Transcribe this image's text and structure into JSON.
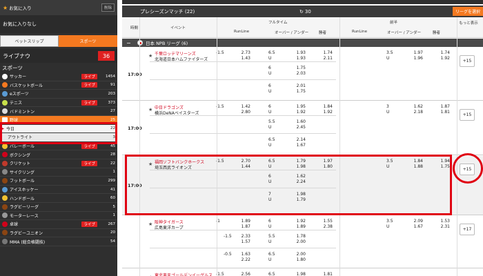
{
  "sidebar": {
    "favorites_title": "お気に入り",
    "favorites_button": "削除",
    "favorites_empty": "お気に入りなし",
    "tabs": [
      "ベットスリップ",
      "スポーツ"
    ],
    "live_now_label": "ライブナウ",
    "live_now_count": "36",
    "sports_header": "スポーツ",
    "sports": [
      {
        "name": "サッカー",
        "live": "ライブ",
        "count": "1454",
        "icon_color": "#ffffff"
      },
      {
        "name": "バスケットボール",
        "live": "ライブ",
        "count": "91",
        "icon_color": "#f47920"
      },
      {
        "name": "eスポーツ",
        "live": "",
        "count": "203",
        "icon_color": "#5a9bd4"
      },
      {
        "name": "テニス",
        "live": "ライブ",
        "count": "373",
        "icon_color": "#c8e04a"
      },
      {
        "name": "バドミントン",
        "live": "",
        "count": "27",
        "icon_color": "#dddddd"
      },
      {
        "name": "野球",
        "live": "",
        "count": "25",
        "icon_color": "#ffffff",
        "selected": true
      },
      {
        "name": "今日",
        "live": "",
        "count": "22",
        "icon_color": "",
        "sub": true
      },
      {
        "name": "アウトライト",
        "live": "",
        "count": "3",
        "icon_color": "",
        "sub2": true
      },
      {
        "name": "バレーボール",
        "live": "ライブ",
        "count": "45",
        "icon_color": "#f2c230"
      },
      {
        "name": "ボクシング",
        "live": "",
        "count": "28",
        "icon_color": "#d0021b"
      },
      {
        "name": "クリケット",
        "live": "ライブ",
        "count": "22",
        "icon_color": "#c0392b"
      },
      {
        "name": "サイクリング",
        "live": "",
        "count": "1",
        "icon_color": "#888888"
      },
      {
        "name": "フットボール",
        "live": "",
        "count": "299",
        "icon_color": "#8b4513"
      },
      {
        "name": "アイスホッケー",
        "live": "",
        "count": "41",
        "icon_color": "#5a9bd4"
      },
      {
        "name": "ハンドボール",
        "live": "",
        "count": "60",
        "icon_color": "#f2c230"
      },
      {
        "name": "ラグビーリーグ",
        "live": "",
        "count": "5",
        "icon_color": "#8b4513"
      },
      {
        "name": "モーターレース",
        "live": "",
        "count": "1",
        "icon_color": "#999999"
      },
      {
        "name": "卓球",
        "live": "ライブ",
        "count": "267",
        "icon_color": "#d0021b"
      },
      {
        "name": "ラグビーユニオン",
        "live": "",
        "count": "20",
        "icon_color": "#8b4513"
      },
      {
        "name": "MMA (総合格闘技)",
        "live": "",
        "count": "54",
        "icon_color": "#777777"
      }
    ]
  },
  "main": {
    "title": "プレシーズンマッチ (22)",
    "refresh_count": "30",
    "order_button": "リーグを選択",
    "headers": {
      "time": "時間",
      "event": "イベント",
      "full_time": "フルタイム",
      "first_half": "前半",
      "runline": "RunLine",
      "over_under": "オーバー / アンダー",
      "win": "勝者",
      "more_display": "もっと表示"
    },
    "league": "日本 NPB リーグ (6)",
    "matches": [
      {
        "time": "17:00",
        "home": "千葉ロッテマリーンズ",
        "away": "北海道日本ハムファイターズ",
        "rl_h": "-1.5",
        "rl_ho": "2.73",
        "rl_ao": "1.43",
        "ou_line": "6.5",
        "ou_o": "1.93",
        "ou_u": "1.93",
        "w1": "1.74",
        "w2": "2.11",
        "h_rl": "3.5",
        "h_o": "1.97",
        "h_u": "1.96",
        "hw1": "1.74",
        "hw2": "1.92",
        "alts": [
          {
            "line": "6",
            "o": "1.75",
            "u": "2.03"
          },
          {
            "line": "6",
            "o": "2.01",
            "u": "1.75"
          }
        ],
        "more": "+15"
      },
      {
        "time": "17:00",
        "home": "中日ドラゴンズ",
        "away": "横浜DeNAベイスターズ",
        "rl_h": "-1.5",
        "rl_ho": "1.42",
        "rl_ao": "2.80",
        "ou_line": "6",
        "ou_o": "1.95",
        "ou_u": "1.92",
        "w1": "1.84",
        "w2": "1.92",
        "h_rl": "3",
        "h_o": "1.62",
        "h_u": "2.18",
        "hw1": "1.87",
        "hw2": "1.81",
        "alts": [
          {
            "line": "5.5",
            "o": "1.60",
            "u": "2.45"
          },
          {
            "line": "6.5",
            "o": "2.14",
            "u": "1.67"
          }
        ],
        "more": "+15"
      },
      {
        "time": "17:00",
        "home": "福岡ソフトバンクホークス",
        "away": "埼玉西武ライオンズ",
        "rl_h": "-1.5",
        "rl_ho": "2.70",
        "rl_ao": "1.44",
        "ou_line": "6.5",
        "ou_o": "1.79",
        "ou_u": "1.98",
        "w1": "1.97",
        "w2": "1.80",
        "h_rl": "3.5",
        "h_o": "1.84",
        "h_u": "1.88",
        "hw1": "1.94",
        "hw2": "1.75",
        "alts": [
          {
            "line": "6",
            "o": "1.62",
            "u": "2.24"
          },
          {
            "line": "7",
            "o": "1.98",
            "u": "1.79"
          }
        ],
        "more": "+15"
      },
      {
        "time": "",
        "home": "阪神タイガース",
        "away": "広島東洋カープ",
        "rl_h": "-1",
        "rl_ho": "1.89",
        "rl_ao": "1.87",
        "ou_line": "6",
        "ou_o": "1.92",
        "ou_u": "1.89",
        "w1": "1.55",
        "w2": "2.38",
        "h_rl": "3.5",
        "h_o": "2.09",
        "h_u": "1.67",
        "hw1": "1.53",
        "hw2": "2.31",
        "alts": [
          {
            "rl": "-1.5",
            "rlo": "2.33",
            "rlu": "1.57",
            "line": "5.5",
            "o": "1.78",
            "u": "2.00"
          },
          {
            "rl": "-0.5",
            "rlo": "1.63",
            "rlu": "2.22",
            "line": "6.5",
            "o": "2.00",
            "u": "1.80"
          }
        ],
        "more": "+17"
      },
      {
        "time": "",
        "home": "東北楽天ゴールデンイーグルス",
        "away": "",
        "rl_h": "-1.5",
        "rl_ho": "2.56",
        "rl_ao": "",
        "ou_line": "6.5",
        "ou_o": "1.98",
        "ou_u": "",
        "w1": "1.81",
        "w2": "",
        "h_rl": "",
        "h_o": "",
        "h_u": "",
        "hw1": "",
        "hw2": "",
        "alts": [],
        "more": ""
      }
    ]
  },
  "colors": {
    "accent": "#f47920",
    "live_red": "#e02020",
    "highlight_red": "#e00012",
    "home_team": "#d0021b"
  }
}
